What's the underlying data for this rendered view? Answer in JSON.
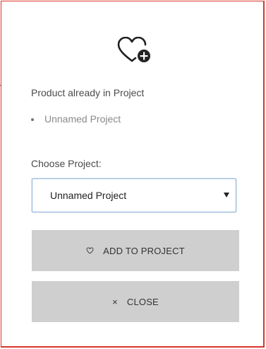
{
  "dialog": {
    "already_in_label": "Product already in Project",
    "existing_projects": [
      "Unnamed Project"
    ],
    "choose_label": "Choose Project:",
    "selected_project": "Unnamed Project",
    "add_button_label": "ADD TO PROJECT",
    "close_button_label": "CLOSE",
    "close_glyph": "×",
    "icons": {
      "header": "heart-plus-icon",
      "add": "heart-outline-icon",
      "dropdown": "caret-down-icon",
      "close": "close-x-icon"
    },
    "colors": {
      "frame_border": "#d9342b",
      "button_bg": "#cfcfcf",
      "select_border": "#8fb3d9"
    }
  }
}
